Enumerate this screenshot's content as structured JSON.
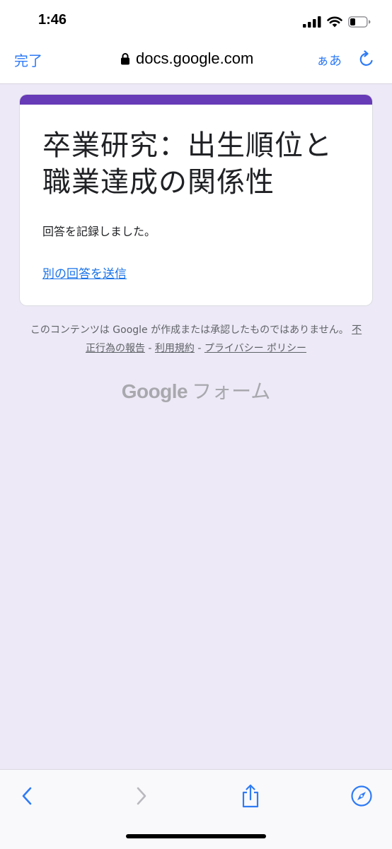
{
  "status_bar": {
    "time": "1:46"
  },
  "browser": {
    "done_label": "完了",
    "url": "docs.google.com",
    "text_size_label": "ぁあ"
  },
  "form": {
    "title": "卒業研究：出生順位と職業達成の関係性",
    "message": "回答を記録しました。",
    "resubmit_link": "別の回答を送信"
  },
  "footer": {
    "disclaimer": "このコンテンツは Google が作成または承認したものではありません。",
    "links": {
      "report": "不正行為の報告",
      "terms": "利用規約",
      "privacy": "プライバシー ポリシー"
    },
    "separator": " - ",
    "brand_google": "Google",
    "brand_forms": "フォーム"
  },
  "colors": {
    "accent": "#673ab7",
    "link": "#1a73e8",
    "ios_blue": "#2f7bf6",
    "background": "#ede9f6"
  }
}
